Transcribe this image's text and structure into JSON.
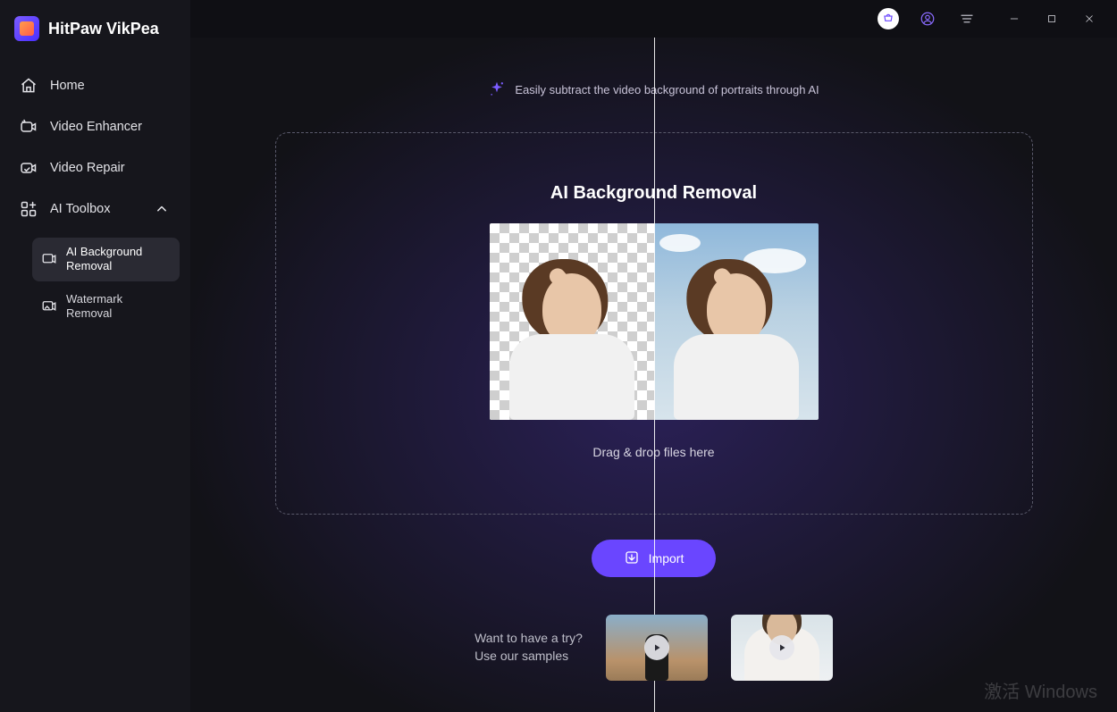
{
  "brand": {
    "name": "HitPaw VikPea"
  },
  "sidebar": {
    "items": [
      {
        "label": "Home"
      },
      {
        "label": "Video Enhancer"
      },
      {
        "label": "Video Repair"
      },
      {
        "label": "AI Toolbox"
      }
    ],
    "sub": [
      {
        "label": "AI Background Removal"
      },
      {
        "label": "Watermark Removal"
      }
    ]
  },
  "headline": "Easily subtract the video background of portraits through AI",
  "dropzone": {
    "title": "AI Background Removal",
    "hint": "Drag & drop files here"
  },
  "import_label": "Import",
  "samples": {
    "line1": "Want to have a try?",
    "line2": "Use our samples"
  },
  "watermark": "激活 Windows"
}
